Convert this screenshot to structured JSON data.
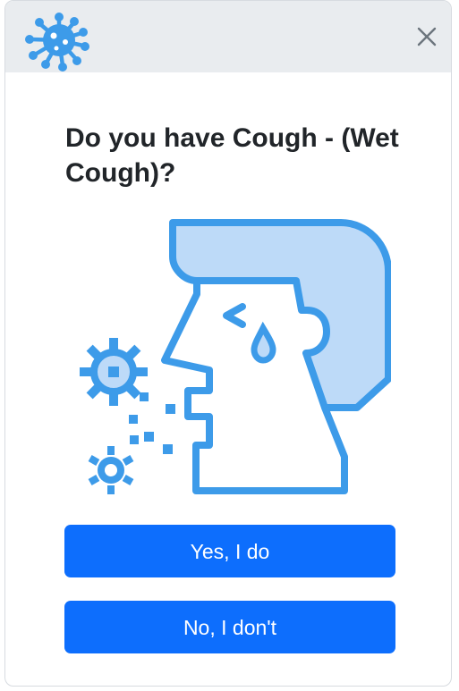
{
  "dialog": {
    "question": "Do you have Cough - (Wet Cough)?",
    "buttons": {
      "yes_label": "Yes, I do",
      "no_label": "No, I don't"
    }
  },
  "icons": {
    "logo": "virus-icon",
    "close": "close-icon",
    "illustration": "coughing-head-icon"
  },
  "colors": {
    "header_bg": "#e9ecef",
    "primary_button": "#0d6efd",
    "illustration_stroke": "#3d9be9",
    "illustration_fill": "#bddaf8",
    "title_text": "#212529"
  }
}
